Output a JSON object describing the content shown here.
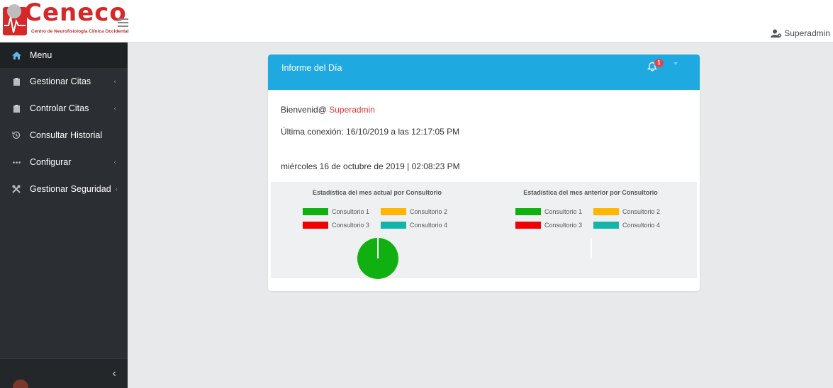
{
  "header": {
    "brand": "Ceneco",
    "tagline": "Centro de Neurofisiología Clínica Occidental",
    "user_name": "Superadmin"
  },
  "sidebar": {
    "items": [
      {
        "label": "Menu",
        "icon": "home-icon",
        "active": true
      },
      {
        "label": "Gestionar Citas",
        "icon": "clipboard-icon"
      },
      {
        "label": "Controlar Citas",
        "icon": "clipboard-icon"
      },
      {
        "label": "Consultar Historial",
        "icon": "history-icon"
      },
      {
        "label": "Configurar",
        "icon": "ellipsis-icon"
      },
      {
        "label": "Gestionar Seguridad",
        "icon": "tools-icon"
      }
    ],
    "collapse_glyph": "‹"
  },
  "report": {
    "title": "Informe del Día",
    "notification_count": "1",
    "welcome_prefix": "Bienvenid@",
    "welcome_user": "Superadmin",
    "last_login": "Última conexión: 16/10/2019 a las 12:17:05 PM",
    "current_date": "miércoles 16 de octubre de 2019 | 02:08:23 PM"
  },
  "colors": {
    "accent": "#1fa9e1",
    "consultorio_1": "#11b011",
    "consultorio_2": "#ffb600",
    "consultorio_3": "#f20000",
    "consultorio_4": "#12b5a9"
  },
  "chart_data": [
    {
      "type": "pie",
      "title": "Estadística del mes actual por Consultorio",
      "categories": [
        "Consultorio 1",
        "Consultorio 2",
        "Consultorio 3",
        "Consultorio 4"
      ],
      "values": [
        1,
        0,
        0,
        0
      ]
    },
    {
      "type": "pie",
      "title": "Estadística del mes anterior por Consultorio",
      "categories": [
        "Consultorio 1",
        "Consultorio 2",
        "Consultorio 3",
        "Consultorio 4"
      ],
      "values": [
        0,
        0,
        0,
        0
      ]
    }
  ]
}
